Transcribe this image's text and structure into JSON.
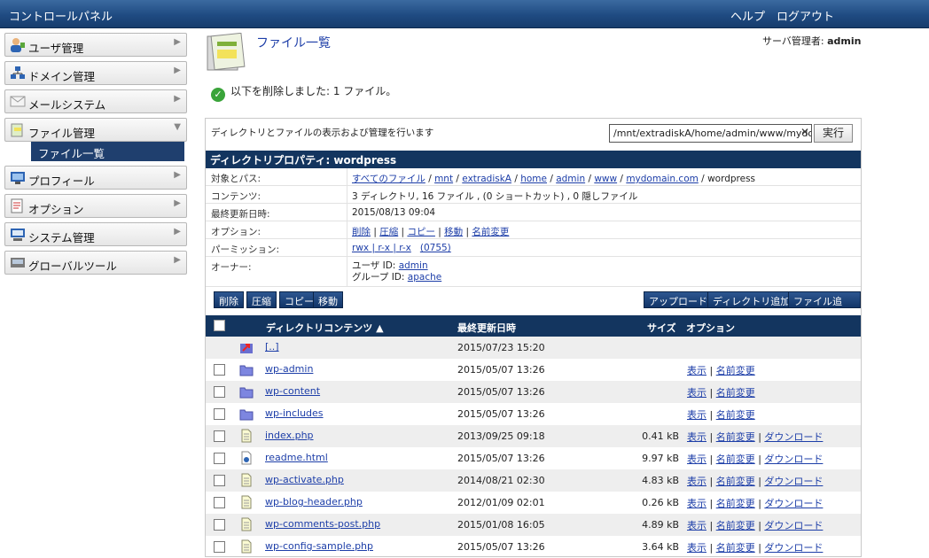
{
  "topbar": {
    "title": "コントロールパネル",
    "help": "ヘルプ",
    "logout": "ログアウト"
  },
  "sidebar": {
    "items": [
      {
        "label": "ユーザ管理",
        "icon": "user-icon"
      },
      {
        "label": "ドメイン管理",
        "icon": "network-icon"
      },
      {
        "label": "メールシステム",
        "icon": "mail-icon"
      },
      {
        "label": "ファイル管理",
        "icon": "file-manage-icon"
      },
      {
        "label": "プロフィール",
        "icon": "profile-icon"
      },
      {
        "label": "オプション",
        "icon": "option-icon"
      },
      {
        "label": "システム管理",
        "icon": "system-icon"
      },
      {
        "label": "グローバルツール",
        "icon": "tools-icon"
      }
    ],
    "sub_item": "ファイル一覧"
  },
  "page": {
    "title": "ファイル一覧",
    "admin_label": "サーバ管理者:",
    "admin_name": "admin",
    "success_message": "以下を削除しました: 1 ファイル。",
    "description": "ディレクトリとファイルの表示および管理を行います",
    "path_value": "/mnt/extradiskA/home/admin/www/mydom",
    "run_button": "実行"
  },
  "properties": {
    "header": "ディレクトリプロパティ: wordpress",
    "rows": [
      {
        "key": "対象とパス:"
      },
      {
        "key": "コンテンツ:",
        "value": "3 ディレクトリ, 16 ファイル , (0 ショートカット) , 0 隠しファイル"
      },
      {
        "key": "最終更新日時:",
        "value": "2015/08/13 09:04"
      },
      {
        "key": "オプション:"
      },
      {
        "key": "パーミッション:"
      },
      {
        "key": "オーナー:"
      }
    ],
    "path_links": [
      "すべてのファイル",
      "mnt",
      "extradiskA",
      "home",
      "admin",
      "www",
      "mydomain.com"
    ],
    "path_current": "wordpress",
    "option_links": [
      "削除",
      "圧縮",
      "コピー",
      "移動",
      "名前変更"
    ],
    "permission_link": "rwx | r-x | r-x",
    "permission_octal": "(0755)",
    "owner_user_label": "ユーザ ID:",
    "owner_user": "admin",
    "owner_group_label": "グループ ID:",
    "owner_group": "apache"
  },
  "toolbar": {
    "delete": "削除",
    "compress": "圧縮",
    "copy": "コピー",
    "move": "移動",
    "upload": "アップロード...",
    "add_dir": "ディレクトリ追加...",
    "add_file": "ファイル追加..."
  },
  "table": {
    "headers": {
      "name": "ディレクトリコンテンツ",
      "sort_icon": "sort-up-icon",
      "date": "最終更新日時",
      "size": "サイズ",
      "options": "オプション"
    },
    "size_unit": "kB",
    "option_view": "表示",
    "option_rename": "名前変更",
    "option_download": "ダウンロード",
    "rows": [
      {
        "name": "[..]",
        "date": "2015/07/23 15:20",
        "type": "up"
      },
      {
        "name": "wp-admin",
        "date": "2015/05/07 13:26",
        "type": "folder"
      },
      {
        "name": "wp-content",
        "date": "2015/05/07 13:26",
        "type": "folder"
      },
      {
        "name": "wp-includes",
        "date": "2015/05/07 13:26",
        "type": "folder"
      },
      {
        "name": "index.php",
        "date": "2013/09/25 09:18",
        "size": "0.41",
        "type": "file"
      },
      {
        "name": "readme.html",
        "date": "2015/05/07 13:26",
        "size": "9.97",
        "type": "html"
      },
      {
        "name": "wp-activate.php",
        "date": "2014/08/21 02:30",
        "size": "4.83",
        "type": "file"
      },
      {
        "name": "wp-blog-header.php",
        "date": "2012/01/09 02:01",
        "size": "0.26",
        "type": "file"
      },
      {
        "name": "wp-comments-post.php",
        "date": "2015/01/08 16:05",
        "size": "4.89",
        "type": "file"
      },
      {
        "name": "wp-config-sample.php",
        "date": "2015/05/07 13:26",
        "size": "3.64",
        "type": "file"
      }
    ]
  },
  "colors": {
    "header_bar": "#13355f",
    "link": "#1d3ea8",
    "alt_row": "#eeeeee"
  }
}
